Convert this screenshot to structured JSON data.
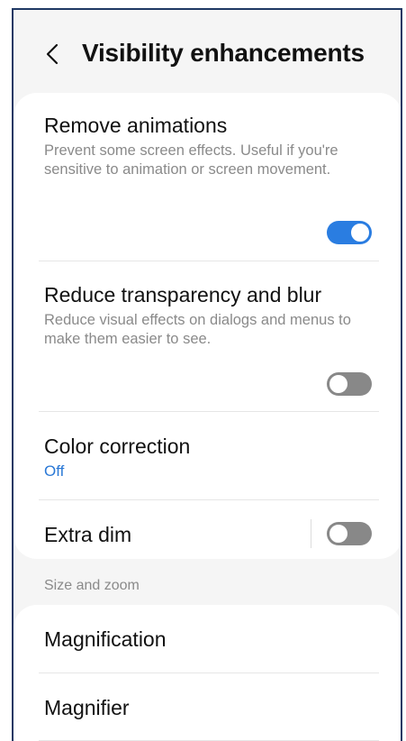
{
  "header": {
    "back_icon": "chevron-left-icon",
    "title": "Visibility enhancements"
  },
  "visibility": {
    "items": [
      {
        "title": "Remove animations",
        "description": "Prevent some screen effects. Useful if you're sensitive to animation or screen movement.",
        "toggle": "on"
      },
      {
        "title": "Reduce transparency and blur",
        "description": "Reduce visual effects on dialogs and menus to make them easier to see.",
        "toggle": "off"
      },
      {
        "title": "Color correction",
        "status": "Off"
      },
      {
        "title": "Extra dim",
        "toggle": "off"
      }
    ]
  },
  "size_and_zoom": {
    "section_label": "Size and zoom",
    "items": [
      {
        "title": "Magnification"
      },
      {
        "title": "Magnifier"
      }
    ]
  },
  "colors": {
    "accent": "#2a7de1",
    "status_text": "#2a78d6",
    "toggle_off": "#888888",
    "frame_border": "#1f3864"
  }
}
